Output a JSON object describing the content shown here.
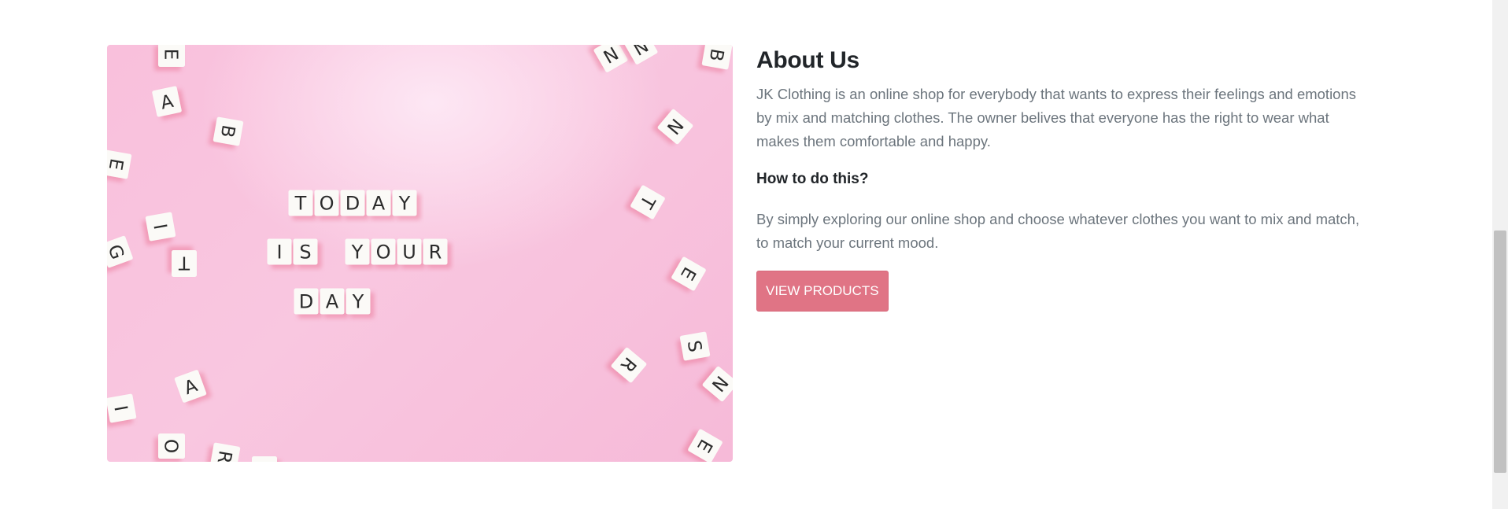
{
  "about": {
    "title": "About Us",
    "description": "JK Clothing is an online shop for everybody that wants to express their feelings and emotions by mix and matching clothes. The owner belives that everyone has the right to wear what makes them comfortable and happy.",
    "subheading": "How to do this?",
    "how_description": "By simply exploring our online shop and choose whatever clothes you want to mix and match, to match your current mood.",
    "button_label": "VIEW PRODUCTS"
  },
  "image": {
    "alt": "TODAY IS YOUR DAY",
    "tile_lines": [
      "TODAY",
      "IS YOUR",
      "DAY"
    ]
  },
  "colors": {
    "accent": "#e07485",
    "heading": "#212529",
    "body_text": "#6c757d",
    "image_bg": "#f9c0dc"
  }
}
